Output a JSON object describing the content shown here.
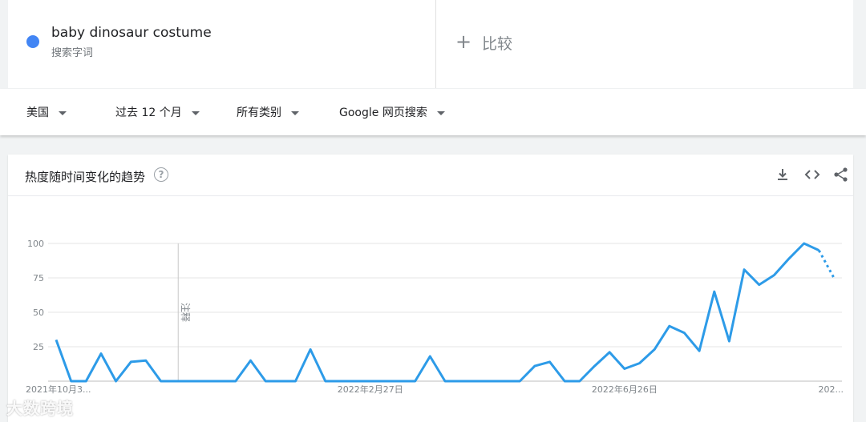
{
  "search_term": {
    "name": "baby dinosaur costume",
    "type": "搜索字词",
    "color": "#4285f4"
  },
  "compare": {
    "plus": "+",
    "label": "比较"
  },
  "filters": {
    "region": "美国",
    "time": "过去 12 个月",
    "category": "所有类别",
    "property": "Google 网页搜索"
  },
  "card": {
    "title": "热度随时间变化的趋势",
    "help": "?",
    "actions": [
      "download-icon",
      "embed-icon",
      "share-icon"
    ]
  },
  "watermark": "大数跨境",
  "chart_data": {
    "type": "line",
    "y_ticks": [
      25,
      50,
      75,
      100
    ],
    "ylim": [
      0,
      100
    ],
    "x_tick_labels": [
      "2021年10月3...",
      "2022年2月27日",
      "2022年6月26日",
      "202..."
    ],
    "x_tick_indices": [
      0,
      21,
      38,
      52
    ],
    "annotation": {
      "label": "注释",
      "index": 8
    },
    "line_color": "#2d9be8",
    "partial_from_index": 51,
    "grid": true,
    "series": [
      {
        "values": [
          30,
          0,
          0,
          20,
          0,
          14,
          15,
          0,
          0,
          0,
          0,
          0,
          0,
          15,
          0,
          0,
          0,
          23,
          0,
          0,
          0,
          0,
          0,
          0,
          0,
          18,
          0,
          0,
          0,
          0,
          0,
          0,
          11,
          14,
          0,
          0,
          11,
          21,
          9,
          13,
          23,
          40,
          35,
          22,
          65,
          29,
          81,
          70,
          77,
          89,
          100,
          95,
          75
        ]
      }
    ]
  }
}
